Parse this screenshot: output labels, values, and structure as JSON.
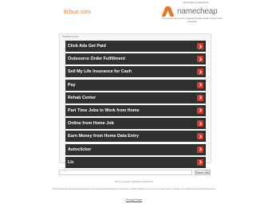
{
  "header": {
    "domain": "itcbuo.com",
    "registration_notice": "This domain is registered at",
    "registrar_name": "namecheap",
    "registrar_tagline": "This domain was recently registered at Namecheap. Please check back later!"
  },
  "panel": {
    "title": "Related Links"
  },
  "links": [
    {
      "label": "Click Ads Get Paid"
    },
    {
      "label": "Outsource Order Fulfillment"
    },
    {
      "label": "Sell My Life Insurance for Cash"
    },
    {
      "label": "Pay"
    },
    {
      "label": "Rehab Center"
    },
    {
      "label": "Part Time Jobs in Work from Home"
    },
    {
      "label": "Online from Home Job"
    },
    {
      "label": "Earn Money from Home Data Entry"
    },
    {
      "label": "Autoclicker"
    },
    {
      "label": "Llc"
    }
  ],
  "search": {
    "placeholder": "",
    "button_label": "Search Ads"
  },
  "footer": {
    "copyright": "2021 Copyright. All Rights Reserved.",
    "disclaimer": "The Sponsored Listings displayed above are served automatically by a third party. Neither Parking crew nor the domain owner maintain any relationship with the advertisers.",
    "privacy_label": "Privacy Policy"
  },
  "colors": {
    "brand_orange": "#e8772e",
    "item_bg": "#303030",
    "arrow_red": "#c8402c"
  },
  "icons": {
    "item_arrow": "chevron-right-icon",
    "logo": "namecheap-logo-icon"
  }
}
